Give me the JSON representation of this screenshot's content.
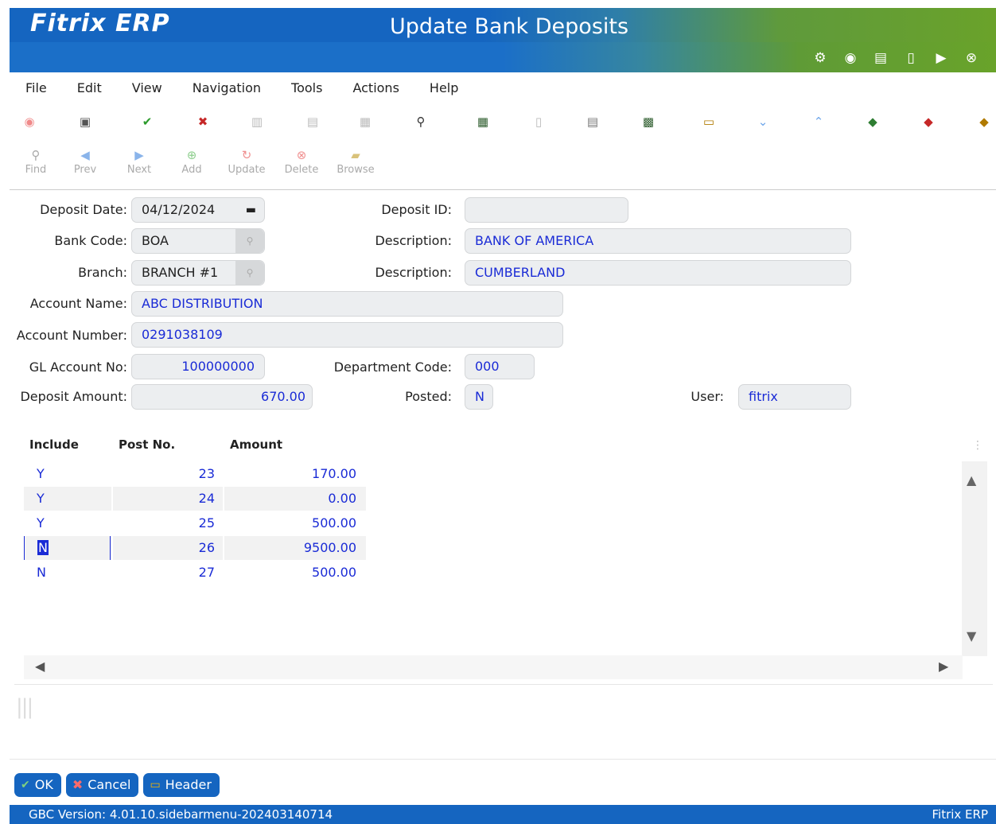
{
  "app": {
    "logo": "Fitrix ERP",
    "title": "Update Bank Deposits",
    "header_icons": [
      "gear-icon",
      "chip-icon",
      "document-icon",
      "new-document-icon",
      "play-icon",
      "close-circle-icon"
    ]
  },
  "menu": [
    "File",
    "Edit",
    "View",
    "Navigation",
    "Tools",
    "Actions",
    "Help"
  ],
  "toolbar2": {
    "find": "Find",
    "prev": "Prev",
    "next": "Next",
    "add": "Add",
    "update": "Update",
    "delete": "Delete",
    "browse": "Browse"
  },
  "form": {
    "deposit_date_label": "Deposit Date:",
    "deposit_date": "04/12/2024",
    "deposit_id_label": "Deposit ID:",
    "deposit_id": "",
    "bank_code_label": "Bank Code:",
    "bank_code": "BOA",
    "bank_desc_label": "Description:",
    "bank_desc": "BANK OF AMERICA",
    "branch_label": "Branch:",
    "branch": "BRANCH #1",
    "branch_desc_label": "Description:",
    "branch_desc": "CUMBERLAND",
    "account_name_label": "Account Name:",
    "account_name": "ABC DISTRIBUTION",
    "account_number_label": "Account Number:",
    "account_number": "0291038109",
    "gl_account_label": "GL Account No:",
    "gl_account": "100000000",
    "dept_code_label": "Department Code:",
    "dept_code": "000",
    "deposit_amount_label": "Deposit Amount:",
    "deposit_amount": "670.00",
    "posted_label": "Posted:",
    "posted": "N",
    "user_label": "User:",
    "user": "fitrix"
  },
  "grid": {
    "headers": [
      "Include",
      "Post No.",
      "Amount"
    ],
    "rows": [
      {
        "include": "Y",
        "post_no": "23",
        "amount": "170.00"
      },
      {
        "include": "Y",
        "post_no": "24",
        "amount": "0.00"
      },
      {
        "include": "Y",
        "post_no": "25",
        "amount": "500.00"
      },
      {
        "include": "N",
        "post_no": "26",
        "amount": "9500.00"
      },
      {
        "include": "N",
        "post_no": "27",
        "amount": "500.00"
      }
    ]
  },
  "buttons": {
    "ok": "OK",
    "cancel": "Cancel",
    "header": "Header"
  },
  "status": {
    "version": "GBC Version: 4.01.10.sidebarmenu-202403140714",
    "brand": "Fitrix ERP"
  }
}
